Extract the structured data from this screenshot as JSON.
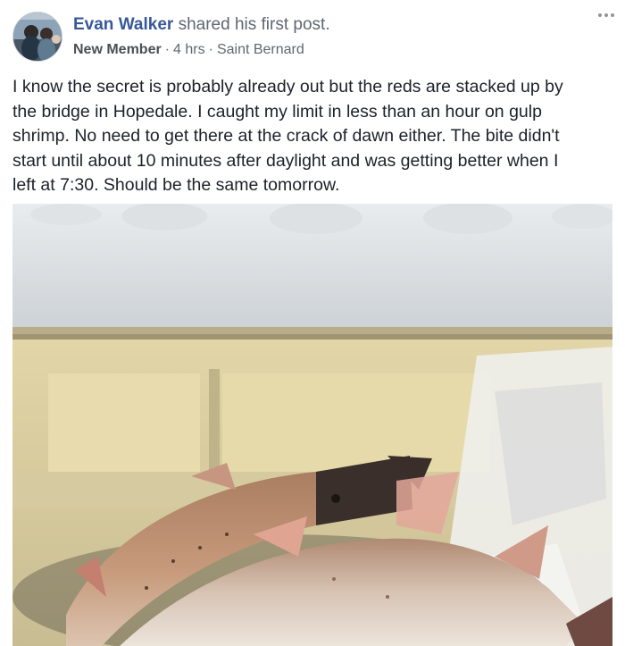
{
  "post": {
    "author": "Evan Walker",
    "action": "shared his first post.",
    "badge": "New Member",
    "time": "4 hrs",
    "location": "Saint Bernard",
    "text": "I know the secret is probably already out but the reds are stacked up by\nthe bridge in Hopedale. I caught my limit in less than an hour on gulp\nshrimp. No need to get there at the crack of dawn either. The bite didn't\nstart until about 10 minutes after daylight and was getting better when I\nleft at 7:30. Should be the same tomorrow."
  },
  "icons": {
    "more": "more-options-icon",
    "separator": "·"
  },
  "colors": {
    "author_link": "#385898",
    "secondary_text": "#606770",
    "body_text": "#1d2129"
  }
}
